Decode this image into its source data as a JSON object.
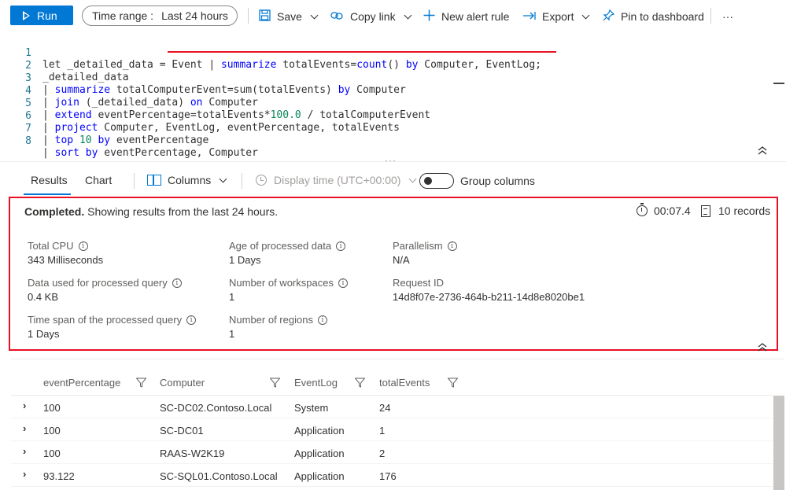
{
  "toolbar": {
    "run_label": "Run",
    "time_range_label": "Time range :",
    "time_range_value": "Last 24 hours",
    "save_label": "Save",
    "copy_link_label": "Copy link",
    "new_alert_label": "New alert rule",
    "export_label": "Export",
    "pin_label": "Pin to dashboard",
    "more_label": "···"
  },
  "editor": {
    "line_numbers": [
      "1",
      "2",
      "3",
      "4",
      "5",
      "6",
      "7",
      "8"
    ],
    "l1": {
      "a": "let _detailed_data = Event | ",
      "kw1": "summarize",
      "b": " totalEvents=",
      "fn1": "count",
      "c": "() ",
      "kw2": "by",
      "d": " Computer, EventLog;"
    },
    "l2": {
      "a": "_detailed_data"
    },
    "l3": {
      "a": "| ",
      "kw1": "summarize",
      "b": " totalComputerEvent=sum(totalEvents) ",
      "kw2": "by",
      "c": " Computer"
    },
    "l4": {
      "a": "| ",
      "kw1": "join",
      "b": " (_detailed_data) ",
      "kw2": "on",
      "c": " Computer"
    },
    "l5": {
      "a": "| ",
      "kw1": "extend",
      "b": " eventPercentage=totalEvents*",
      "num": "100.0",
      "c": " / totalComputerEvent"
    },
    "l6": {
      "a": "| ",
      "kw1": "project",
      "b": " Computer, EventLog, eventPercentage, totalEvents"
    },
    "l7": {
      "a": "| ",
      "kw1": "top",
      "b": " ",
      "num": "10",
      "c": " ",
      "kw2": "by",
      "d": " eventPercentage"
    },
    "l8": {
      "a": "| ",
      "kw1": "sort",
      "b": " ",
      "kw2": "by",
      "c": " eventPercentage, Computer"
    }
  },
  "tabs": {
    "results": "Results",
    "chart": "Chart",
    "columns": "Columns",
    "display_time": "Display time (UTC+00:00)",
    "group_columns": "Group columns"
  },
  "stats": {
    "status_bold": "Completed.",
    "status_rest": " Showing results from the last 24 hours.",
    "elapsed": "00:07.4",
    "records": "10 records",
    "total_cpu_label": "Total CPU",
    "total_cpu_value": "343 Milliseconds",
    "data_used_label": "Data used for processed query",
    "data_used_value": "0.4 KB",
    "time_span_label": "Time span of the processed query",
    "time_span_value": "1 Days",
    "age_label": "Age of processed data",
    "age_value": "1 Days",
    "workspaces_label": "Number of workspaces",
    "workspaces_value": "1",
    "regions_label": "Number of regions",
    "regions_value": "1",
    "parallelism_label": "Parallelism",
    "parallelism_value": "N/A",
    "request_id_label": "Request ID",
    "request_id_value": "14d8f07e-2736-464b-b211-14d8e8020be1",
    "info_glyph": "i"
  },
  "grid": {
    "columns": [
      "eventPercentage",
      "Computer",
      "EventLog",
      "totalEvents"
    ],
    "rows": [
      [
        "100",
        "SC-DC02.Contoso.Local",
        "System",
        "24"
      ],
      [
        "100",
        "SC-DC01",
        "Application",
        "1"
      ],
      [
        "100",
        "RAAS-W2K19",
        "Application",
        "2"
      ],
      [
        "93.122",
        "SC-SQL01.Contoso.Local",
        "Application",
        "176"
      ]
    ]
  },
  "colors": {
    "accent": "#0078d4",
    "highlight_red": "#e81123",
    "keyword_blue": "#0000ff",
    "number_green": "#098658"
  }
}
